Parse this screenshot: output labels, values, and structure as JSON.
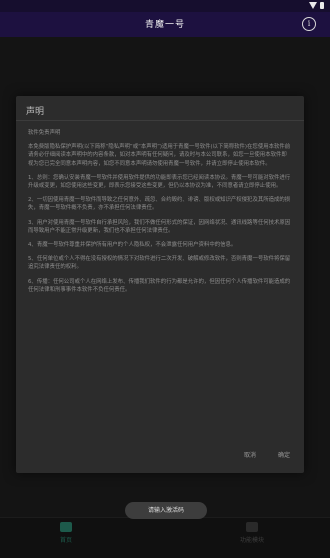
{
  "app": {
    "title": "青魔一号"
  },
  "dialog": {
    "title": "声明",
    "paragraphs": [
      "软件免责声明",
      "本免费版隐私保护声明(以下简称“隐私声明”或“本声明”)适用于青魔一号软件(以下简称软件)在您使用本软件前请务必仔细阅读本声明中的内容条款，如对本声明有任何疑问，请及时与本公司联系，如您一旦使用本软件即视为您已完全同意本声明内容，如您不同意本声明请勿使用青魔一号软件，并请立即停止使用本软件。",
      "1、总则：您确认安装青魔一号软件并使用软件提供的功能即表示您已经阅读本协议。青魔一号可能对软件进行升级或变更，如您使用这些变更，即表示您接受这些变更，但仍以本协议为准，不同意者请立即停止使用。",
      "2、一切因使用青魔一号软件而导致之任何意外、疏忽、合约毁约、诽谤、版权或知识产权侵犯及其所造成的损失，青魔一号软件概不负责，亦不承担任何法律责任。",
      "3、用户对使用青魔一号软件自行承担风险，我们不做任何形式的保证，因网络状况、通讯线路等任何技术原因而导致用户不能正常升级更新，我们也不承担任何法律责任。",
      "4、青魔一号软件尊重并保护所有用户的个人隐私权，不会泄露任何用户资料中的信息。",
      "5、任何单位或个人不得在没有授权的情况下对软件进行二次开发、破解或修改软件，否则青魔一号软件将保留追究法律责任的权利。",
      "6、传播：任何公司或个人在网络上发布、传播我们软件的行为都是允许的，但因任何个人传播软件可能造成的任何法律和刑事事件本软件不负任何责任。"
    ],
    "cancel_label": "取消",
    "confirm_label": "确定"
  },
  "toast": {
    "text": "请输入激活码"
  },
  "nav": {
    "home_label": "首页",
    "mine_label": "功能模块"
  }
}
